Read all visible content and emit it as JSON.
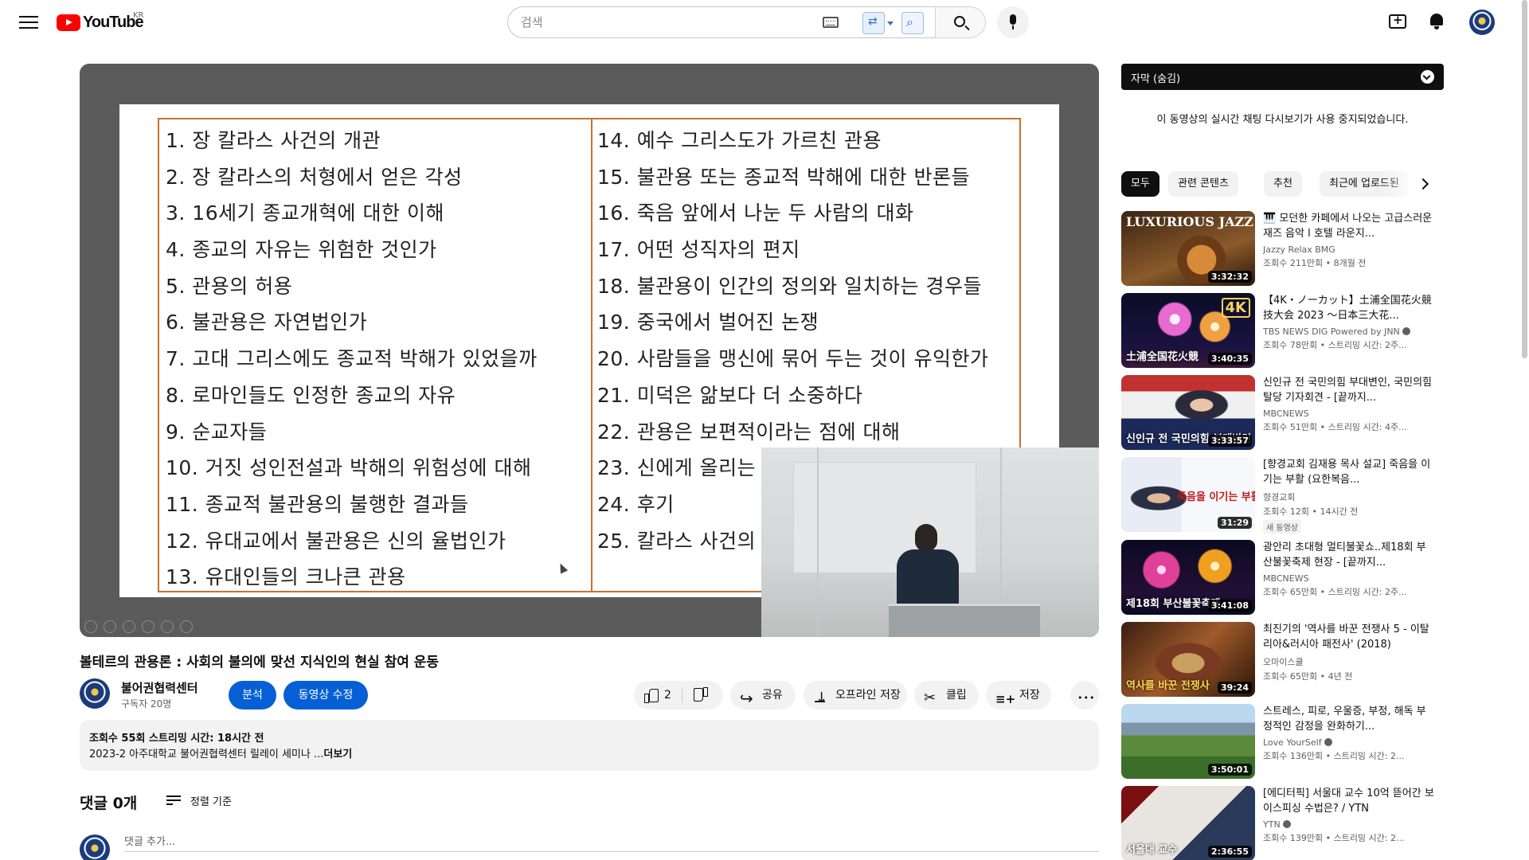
{
  "header": {
    "logo_text": "YouTube",
    "logo_region": "KR",
    "search_placeholder": "검색"
  },
  "video": {
    "slide_left": [
      "1. 장 칼라스 사건의 개관",
      "2. 장 칼라스의 처형에서 얻은 각성",
      "3. 16세기 종교개혁에 대한 이해",
      "4. 종교의 자유는 위험한 것인가",
      "5. 관용의 허용",
      "6. 불관용은 자연법인가",
      "7. 고대 그리스에도 종교적 박해가 있었을까",
      "8. 로마인들도 인정한 종교의 자유",
      "9. 순교자들",
      "10. 거짓 성인전설과 박해의 위험성에 대해",
      "11. 종교적 불관용의 불행한 결과들",
      "12. 유대교에서 불관용은 신의 율법인가",
      "13. 유대인들의 크나큰 관용"
    ],
    "slide_right": [
      "14. 예수 그리스도가 가르친 관용",
      "15. 불관용 또는 종교적 박해에 대한 반론들",
      "16. 죽음 앞에서 나눈 두 사람의 대화",
      "17. 어떤 성직자의 편지",
      "18. 불관용이 인간의 정의와 일치하는 경우들",
      "19. 중국에서 벌어진 논쟁",
      "20. 사람들을 맹신에 묶어 두는 것이 유익한가",
      "21. 미덕은 앎보다 더 소중하다",
      "22. 관용은 보편적이라는 점에 대해",
      "23. 신에게 올리는",
      "24. 후기",
      "25. 칼라스 사건의"
    ],
    "title": "볼테르의 관용론 : 사회의 불의에 맞선 지식인의 현실 참여 운동",
    "channel_name": "불어권협력센터",
    "subscribers": "구독자 20명",
    "analytics_label": "분석",
    "edit_label": "동영상 수정",
    "like_count": "2",
    "share_label": "공유",
    "download_label": "오프라인 저장",
    "clip_label": "클립",
    "save_label": "저장",
    "desc_meta": "조회수 55회  스트리밍 시간: 18시간 전",
    "desc_text": "2023-2 아주대학교 불어권협력센터 릴레이 세미나 ...",
    "desc_more": "더보기",
    "comments_title": "댓글 0개",
    "sort_label": "정렬 기준",
    "comment_placeholder": "댓글 추가..."
  },
  "sidebar": {
    "chat_label": "자막 (숨김)",
    "chat_disabled": "이 동영상의 실시간 채팅 다시보기가 사용 중지되었습니다.",
    "chips": [
      "모두",
      "관련 콘텐츠",
      "추천",
      "최근에 업로드된"
    ],
    "recs": [
      {
        "title": "🎹 모던한 카페에서 나오는 고급스러운 재즈 음악 l 호텔 라운지...",
        "channel": "Jazzy Relax BMG",
        "views": "조회수 211만회 • 8개월 전",
        "duration": "3:32:32",
        "thumb_text": "LUXURIOUS JAZZ"
      },
      {
        "title": "【4K・ノーカット】土浦全国花火競技大会 2023 ～日本三大花...",
        "channel": "TBS NEWS DIG Powered by JNN",
        "views": "조회수 78만회 • 스트리밍 시간: 2주...",
        "duration": "3:40:35",
        "thumb_text": "土浦全国花火競",
        "thumb_badge": "4K"
      },
      {
        "title": "신인규 전 국민의힘 부대변인, 국민의힘 탈당 기자회견 - [끝까지...",
        "channel": "MBCNEWS",
        "views": "조회수 51만회 • 스트리밍 시간: 4주...",
        "duration": "3:33:57",
        "thumb_text": "신인규 전 국민의힘 부대변인"
      },
      {
        "title": "[향경교회 김재용 목사 설교] 죽음을 이기는 부활 (요한복음...",
        "channel": "향경교회",
        "views": "조회수 12회 • 14시간 전",
        "duration": "31:29",
        "thumb_text": "죽음을 이기는 부활",
        "badge_new": "새 동영상"
      },
      {
        "title": "광안리 초대형 멀티불꽃쇼..제18회 부산불꽃축제 현장 - [끝까지...",
        "channel": "MBCNEWS",
        "views": "조회수 65만회 • 스트리밍 시간: 2주...",
        "duration": "3:41:08",
        "thumb_text": "제18회 부산불꽃축제"
      },
      {
        "title": "최진기의 '역사를 바꾼 전쟁사 5 - 이탈리아&러시아 패전사' (2018)",
        "channel": "오마이스쿨",
        "views": "조회수 65만회 • 4년 전",
        "duration": "39:24",
        "thumb_text": "역사를 바꾼 전쟁사"
      },
      {
        "title": "스트레스, 피로, 우울증, 부정, 해독 부정적인 감정을 완화하기...",
        "channel": "Love YourSelf",
        "views": "조회수 136만회 • 스트리밍 시간: 2...",
        "duration": "3:50:01",
        "thumb_text": ""
      },
      {
        "title": "[에디터픽] 서울대 교수 10억 뜯어간 보이스피싱 수법은? / YTN",
        "channel": "YTN",
        "views": "조회수 139만회 • 스트리밍 시간: 2...",
        "duration": "2:36:55",
        "thumb_text": "서울대 교수"
      }
    ]
  }
}
